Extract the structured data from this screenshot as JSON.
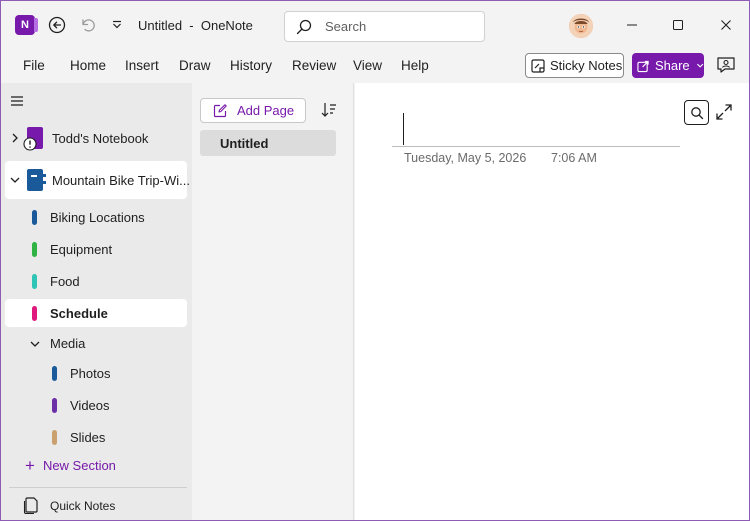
{
  "app": {
    "logo_letter": "N",
    "title": "Untitled  -  OneNote",
    "accent_color": "#7719aa"
  },
  "titlebar": {
    "back_icon": "back-arrow-icon",
    "undo_icon": "undo-icon",
    "customize_icon": "chevron-down-icon",
    "search_placeholder": "Search",
    "minimize_icon": "minimize-icon",
    "maximize_icon": "maximize-icon",
    "close_icon": "close-icon"
  },
  "ribbon": {
    "menu": [
      "File",
      "Home",
      "Insert",
      "Draw",
      "History",
      "Review",
      "View",
      "Help"
    ],
    "sticky_notes_label": "Sticky Notes",
    "share_label": "Share"
  },
  "nav": {
    "notebooks": [
      {
        "label": "Todd's Notebook",
        "color": "#7719aa",
        "expanded": false,
        "warning": true
      },
      {
        "label": "Mountain Bike Trip-Wi...",
        "color": "#1a5a9a",
        "expanded": true
      }
    ],
    "sections": [
      {
        "label": "Biking Locations",
        "color": "#1a5a9a"
      },
      {
        "label": "Equipment",
        "color": "#2fb344"
      },
      {
        "label": "Food",
        "color": "#2ec4b6"
      },
      {
        "label": "Schedule",
        "color": "#e0197d",
        "selected": true
      },
      {
        "label": "Media",
        "group": true
      },
      {
        "label": "Photos",
        "color": "#1a5a9a"
      },
      {
        "label": "Videos",
        "color": "#6b2fa8"
      },
      {
        "label": "Slides",
        "color": "#c9a06e"
      }
    ],
    "new_section_label": "New Section",
    "quick_notes_label": "Quick Notes"
  },
  "pages": {
    "add_page_label": "Add Page",
    "items": [
      {
        "label": "Untitled",
        "selected": true
      }
    ]
  },
  "canvas": {
    "date": "Tuesday, May 5, 2026",
    "time": "7:06 AM"
  }
}
